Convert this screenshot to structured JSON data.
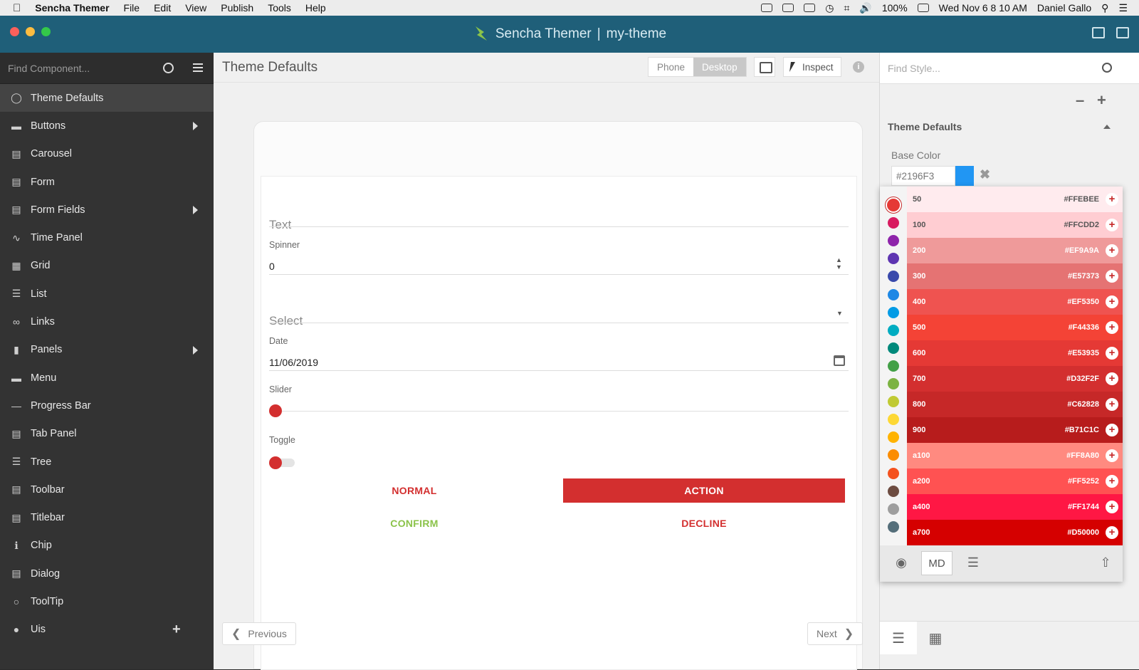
{
  "menubar": {
    "app": "Sencha Themer",
    "menus": [
      "File",
      "Edit",
      "View",
      "Publish",
      "Tools",
      "Help"
    ],
    "battery": "100%",
    "datetime": "Wed Nov 6  8 10 AM",
    "user": "Daniel Gallo"
  },
  "window": {
    "title": "Sencha Themer",
    "separator": "|",
    "project": "my-theme"
  },
  "sidebar": {
    "search_placeholder": "Find Component...",
    "items": [
      {
        "label": "Theme Defaults",
        "icon": "globe-icon",
        "active": true
      },
      {
        "label": "Buttons",
        "icon": "button-icon",
        "submenu": true
      },
      {
        "label": "Carousel",
        "icon": "carousel-icon"
      },
      {
        "label": "Form",
        "icon": "form-icon"
      },
      {
        "label": "Form Fields",
        "icon": "form-fields-icon",
        "submenu": true
      },
      {
        "label": "Time Panel",
        "icon": "time-panel-icon"
      },
      {
        "label": "Grid",
        "icon": "grid-icon"
      },
      {
        "label": "List",
        "icon": "list-icon"
      },
      {
        "label": "Links",
        "icon": "link-icon"
      },
      {
        "label": "Panels",
        "icon": "panel-icon",
        "submenu": true
      },
      {
        "label": "Menu",
        "icon": "menu-icon"
      },
      {
        "label": "Progress Bar",
        "icon": "progress-bar-icon"
      },
      {
        "label": "Tab Panel",
        "icon": "tab-panel-icon"
      },
      {
        "label": "Tree",
        "icon": "tree-icon"
      },
      {
        "label": "Toolbar",
        "icon": "toolbar-icon"
      },
      {
        "label": "Titlebar",
        "icon": "titlebar-icon"
      },
      {
        "label": "Chip",
        "icon": "info-icon"
      },
      {
        "label": "Dialog",
        "icon": "dialog-icon"
      },
      {
        "label": "ToolTip",
        "icon": "tooltip-icon"
      },
      {
        "label": "Uis",
        "icon": "user-icon",
        "add": true
      }
    ]
  },
  "main": {
    "title": "Theme Defaults",
    "view_modes": [
      "Phone",
      "Desktop"
    ],
    "selected_view": "Desktop",
    "inspect_label": "Inspect",
    "form": {
      "text_label": "Text",
      "spinner_label": "Spinner",
      "spinner_value": "0",
      "select_label": "Select",
      "date_label": "Date",
      "date_value": "11/06/2019",
      "slider_label": "Slider",
      "slider_value": 0,
      "toggle_label": "Toggle",
      "toggle_on": false,
      "normal_label": "NORMAL",
      "action_label": "ACTION",
      "confirm_label": "CONFIRM",
      "decline_label": "DECLINE"
    },
    "prev_label": "Previous",
    "next_label": "Next"
  },
  "right": {
    "search_placeholder": "Find Style...",
    "section_title": "Theme Defaults",
    "base_color_label": "Base Color",
    "base_color_value": "#2196F3",
    "palette": {
      "selected_dot": 0,
      "dots": [
        "#e53935",
        "#d81b60",
        "#8e24aa",
        "#5e35b1",
        "#3949ab",
        "#1e88e5",
        "#039be5",
        "#00acc1",
        "#00897b",
        "#43a047",
        "#7cb342",
        "#c0ca33",
        "#fdd835",
        "#ffb300",
        "#fb8c00",
        "#f4511e",
        "#6d4c41",
        "#9e9e9e",
        "#546e7a"
      ],
      "shades": [
        {
          "name": "50",
          "hex": "#FFEBEE"
        },
        {
          "name": "100",
          "hex": "#FFCDD2"
        },
        {
          "name": "200",
          "hex": "#EF9A9A"
        },
        {
          "name": "300",
          "hex": "#E57373"
        },
        {
          "name": "400",
          "hex": "#EF5350"
        },
        {
          "name": "500",
          "hex": "#F44336"
        },
        {
          "name": "600",
          "hex": "#E53935"
        },
        {
          "name": "700",
          "hex": "#D32F2F"
        },
        {
          "name": "800",
          "hex": "#C62828"
        },
        {
          "name": "900",
          "hex": "#B71C1C"
        },
        {
          "name": "a100",
          "hex": "#FF8A80"
        },
        {
          "name": "a200",
          "hex": "#FF5252"
        },
        {
          "name": "a400",
          "hex": "#FF1744"
        },
        {
          "name": "a700",
          "hex": "#D50000"
        }
      ],
      "mode_label": "MD"
    }
  },
  "colors": {
    "accent": "#d32f2f",
    "confirm": "#8bc34a",
    "titlebar": "#1f5f79",
    "sidebar": "#333333"
  }
}
